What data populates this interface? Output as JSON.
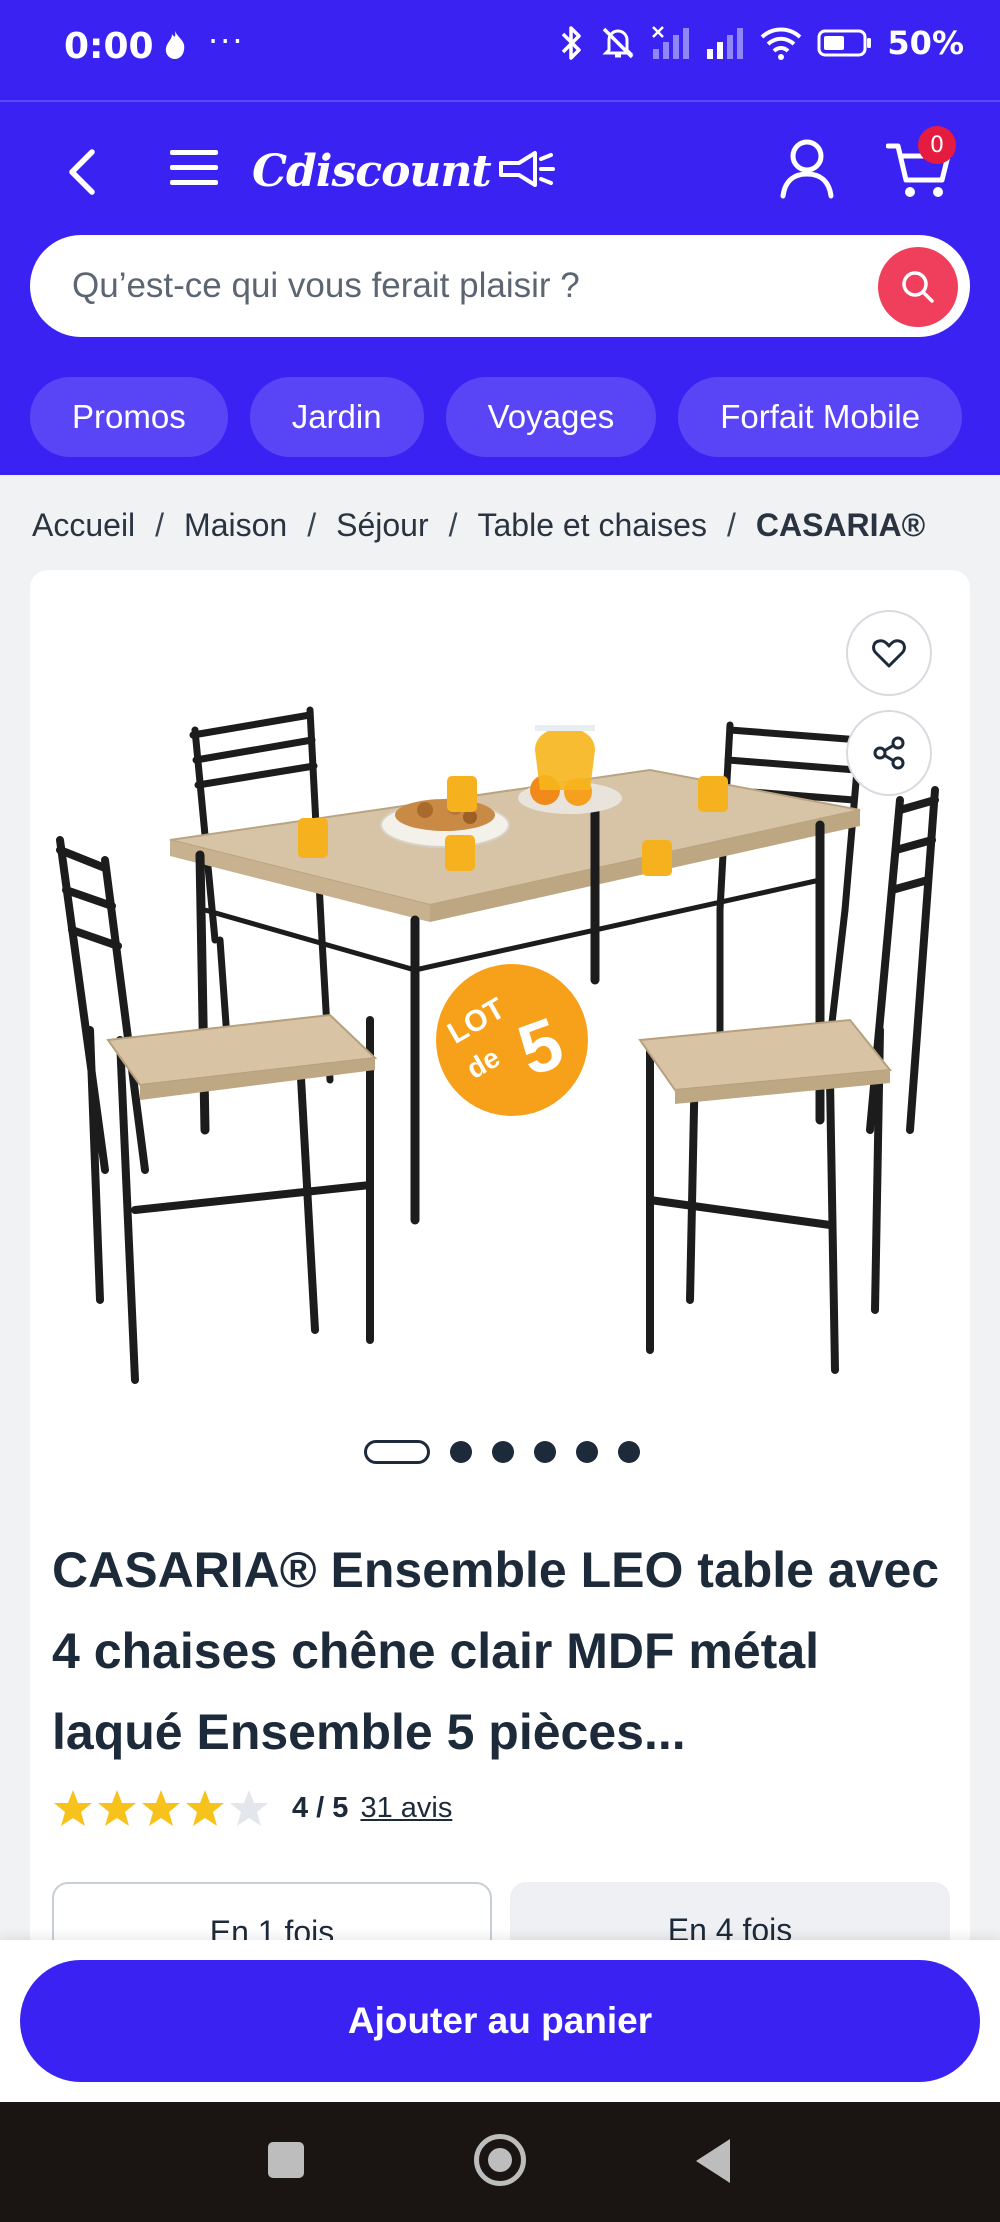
{
  "status_bar": {
    "time": "0:00",
    "more": "···",
    "battery": "50%"
  },
  "header": {
    "logo": "Cdiscount",
    "cart_count": "0",
    "brand_color": "#3a22f2",
    "search": {
      "placeholder": "Qu’est-ce qui vous ferait plaisir ?"
    },
    "chips": [
      "Promos",
      "Jardin",
      "Voyages",
      "Forfait Mobile"
    ]
  },
  "breadcrumb": {
    "items": [
      "Accueil",
      "Maison",
      "Séjour",
      "Table et chaises"
    ],
    "current": "CASARIA®",
    "separator": "/"
  },
  "product": {
    "image_badge": {
      "line1": "LOT",
      "line2": "de",
      "number": "5"
    },
    "gallery": {
      "total": 6,
      "active": 1
    },
    "title": "CASARIA® Ensemble LEO table avec 4 chaises chêne clair MDF métal laqué Ensemble 5 pièces...",
    "rating": {
      "stars": 4,
      "max": 5,
      "text": "4 / 5",
      "reviews": "31 avis"
    },
    "payment_tabs": [
      "En 1 fois",
      "En 4 fois"
    ]
  },
  "actions": {
    "add_to_cart": "Ajouter au panier"
  },
  "icons": [
    "flame-icon",
    "bluetooth-icon",
    "muted-bell-icon",
    "signal-icon",
    "wifi-icon",
    "battery-icon",
    "back-arrow-icon",
    "menu-icon",
    "user-icon",
    "cart-icon",
    "search-icon",
    "heart-icon",
    "share-icon",
    "star-icon"
  ]
}
